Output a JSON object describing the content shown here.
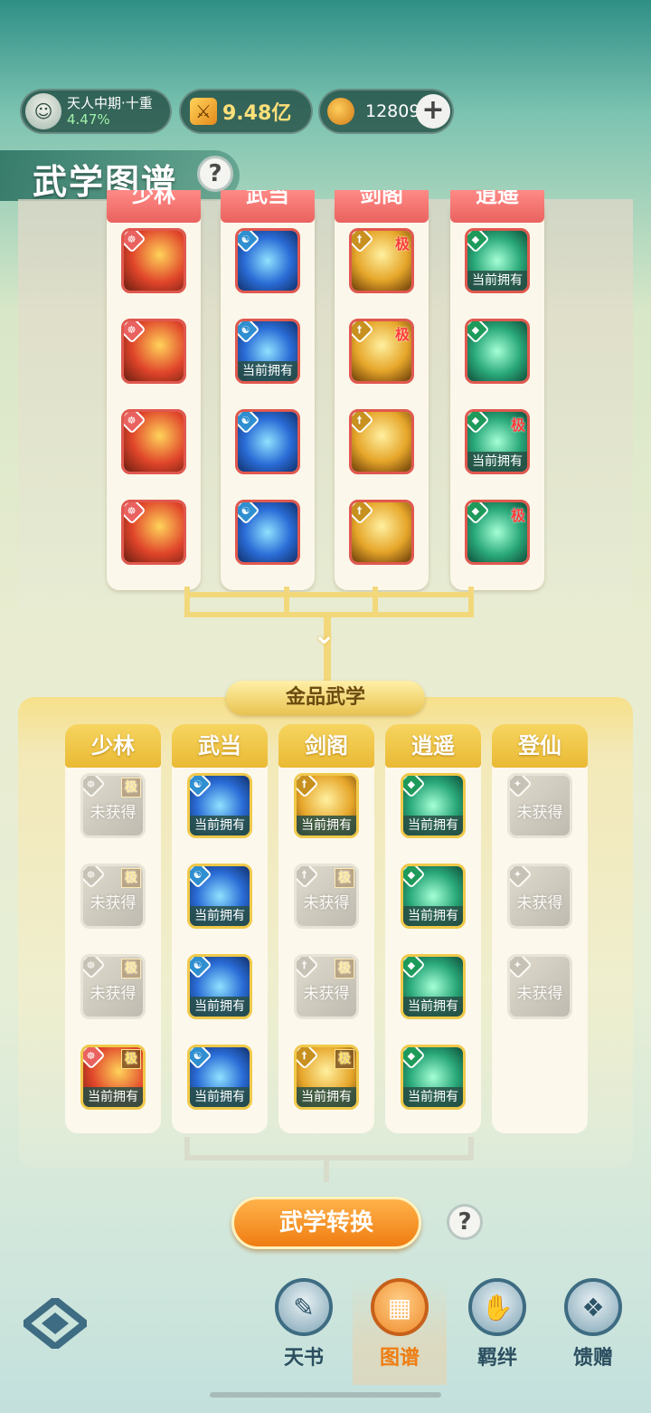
{
  "top_bar": {
    "rank_name": "天人中期·十重",
    "rank_progress": "4.47%",
    "power_value": "9.48亿",
    "currency_value": "12809",
    "plus_label": "+"
  },
  "header": {
    "title": "武学图谱",
    "help_label": "?"
  },
  "labels": {
    "owned": "当前拥有",
    "locked": "未获得",
    "ji": "极"
  },
  "upper": {
    "columns": [
      {
        "name": "少林",
        "color": "#e9625f",
        "tiles": [
          {
            "owned": false,
            "ji": false
          },
          {
            "owned": false,
            "ji": false
          },
          {
            "owned": false,
            "ji": false
          },
          {
            "owned": false,
            "ji": false
          }
        ]
      },
      {
        "name": "武当",
        "color": "#2f8fd0",
        "tiles": [
          {
            "owned": false,
            "ji": false
          },
          {
            "owned": true,
            "ji": false
          },
          {
            "owned": false,
            "ji": false
          },
          {
            "owned": false,
            "ji": false
          }
        ]
      },
      {
        "name": "剑阁",
        "color": "#c7901f",
        "tiles": [
          {
            "owned": false,
            "ji": true
          },
          {
            "owned": false,
            "ji": true
          },
          {
            "owned": false,
            "ji": false
          },
          {
            "owned": false,
            "ji": false
          }
        ]
      },
      {
        "name": "逍遥",
        "color": "#1e9a5a",
        "tiles": [
          {
            "owned": true,
            "ji": false
          },
          {
            "owned": false,
            "ji": false
          },
          {
            "owned": true,
            "ji": true
          },
          {
            "owned": false,
            "ji": true
          }
        ]
      }
    ]
  },
  "gold": {
    "banner": "金品武学",
    "columns": [
      {
        "name": "少林",
        "tiles": [
          "locked-ji",
          "locked-ji",
          "locked-ji",
          "owned-ji"
        ]
      },
      {
        "name": "武当",
        "tiles": [
          "owned",
          "owned",
          "owned",
          "owned"
        ]
      },
      {
        "name": "剑阁",
        "tiles": [
          "owned",
          "locked-ji",
          "locked-ji",
          "owned-ji"
        ]
      },
      {
        "name": "逍遥",
        "tiles": [
          "owned",
          "owned",
          "owned",
          "owned"
        ]
      },
      {
        "name": "登仙",
        "tiles": [
          "locked",
          "locked",
          "locked"
        ]
      }
    ]
  },
  "actions": {
    "convert_label": "武学转换",
    "help_label": "?"
  },
  "nav": {
    "items": [
      {
        "label": "天书",
        "icon": "book-icon"
      },
      {
        "label": "图谱",
        "icon": "map-icon"
      },
      {
        "label": "羁绊",
        "icon": "handshake-icon"
      },
      {
        "label": "馈赠",
        "icon": "gift-bag-icon"
      }
    ],
    "active_index": 1
  },
  "colors": {
    "accent_orange": "#ef7d12",
    "shaolin_red": "#e9625f",
    "gold": "#f0c94a"
  }
}
